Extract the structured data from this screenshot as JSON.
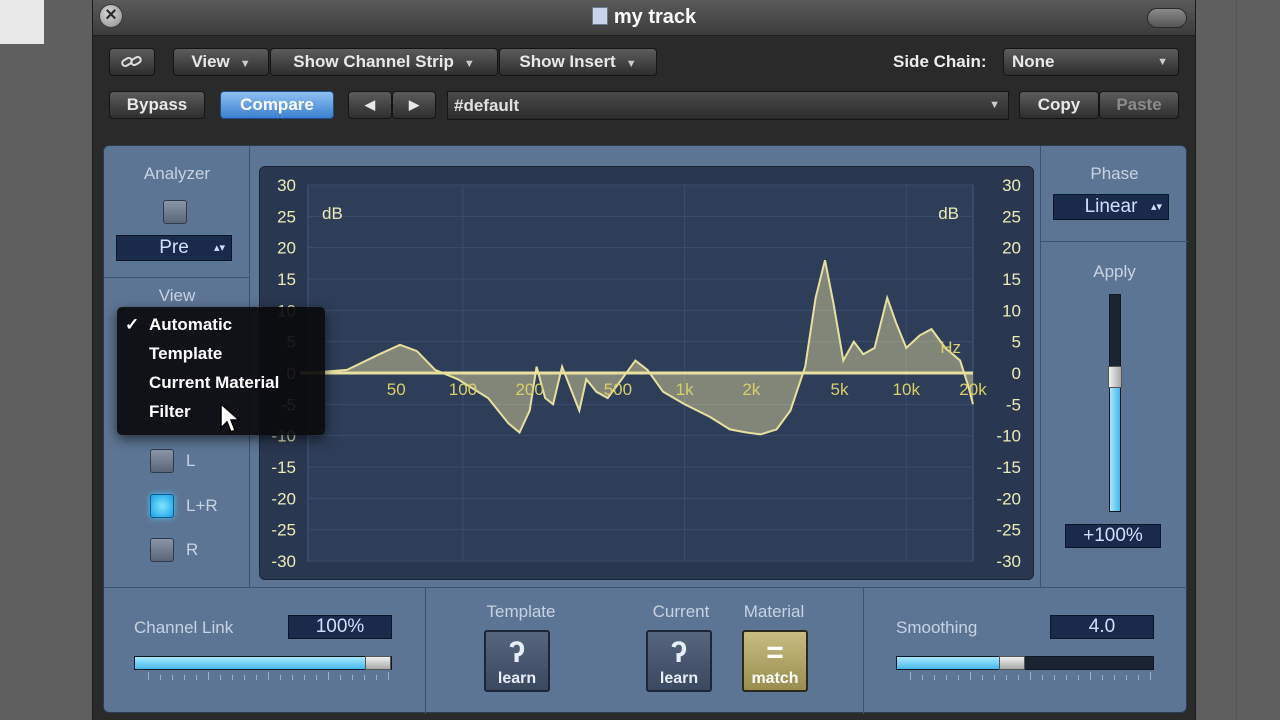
{
  "window": {
    "title": "my track"
  },
  "toolbar": {
    "view_label": "View",
    "show_channel_strip_label": "Show Channel Strip",
    "show_insert_label": "Show Insert",
    "side_chain_label": "Side Chain:",
    "side_chain_value": "None",
    "bypass_label": "Bypass",
    "compare_label": "Compare",
    "prev_symbol": "◀",
    "next_symbol": "▶",
    "preset_value": "#default",
    "copy_label": "Copy",
    "paste_label": "Paste"
  },
  "left_panel": {
    "analyzer_label": "Analyzer",
    "analyzer_mode": "Pre",
    "view_label": "View",
    "channel_l": "L",
    "channel_lr": "L+R",
    "channel_r": "R"
  },
  "view_menu": {
    "items": [
      {
        "label": "Automatic",
        "checked": true
      },
      {
        "label": "Template",
        "checked": false
      },
      {
        "label": "Current Material",
        "checked": false
      },
      {
        "label": "Filter",
        "checked": false
      }
    ]
  },
  "graph": {
    "db_label_left": "dB",
    "db_label_right": "dB",
    "hz_label": "Hz",
    "y_ticks": [
      "30",
      "25",
      "20",
      "15",
      "10",
      "5",
      "0",
      "-5",
      "-10",
      "-15",
      "-20",
      "-25",
      "-30"
    ],
    "x_ticks": [
      "50",
      "100",
      "200",
      "500",
      "1k",
      "2k",
      "5k",
      "10k",
      "20k"
    ],
    "curve_color": "#e8e0a0"
  },
  "right_panel": {
    "phase_label": "Phase",
    "phase_value": "Linear",
    "apply_label": "Apply",
    "apply_value": "+100%",
    "apply_level": 0.62
  },
  "bottom": {
    "channel_link_label": "Channel Link",
    "channel_link_value": "100%",
    "channel_link_level": 0.95,
    "template_label": "Template",
    "current_label": "Current",
    "material_label": "Material",
    "learn_label": "learn",
    "learn_label_2": "learn",
    "match_label": "match",
    "smoothing_label": "Smoothing",
    "smoothing_value": "4.0",
    "smoothing_level": 0.45
  },
  "colors": {
    "accent_blue": "#45b8ec",
    "panel": "#5d7594",
    "graph_bg": "#2a3750",
    "match_gold": "#b8ab68"
  }
}
